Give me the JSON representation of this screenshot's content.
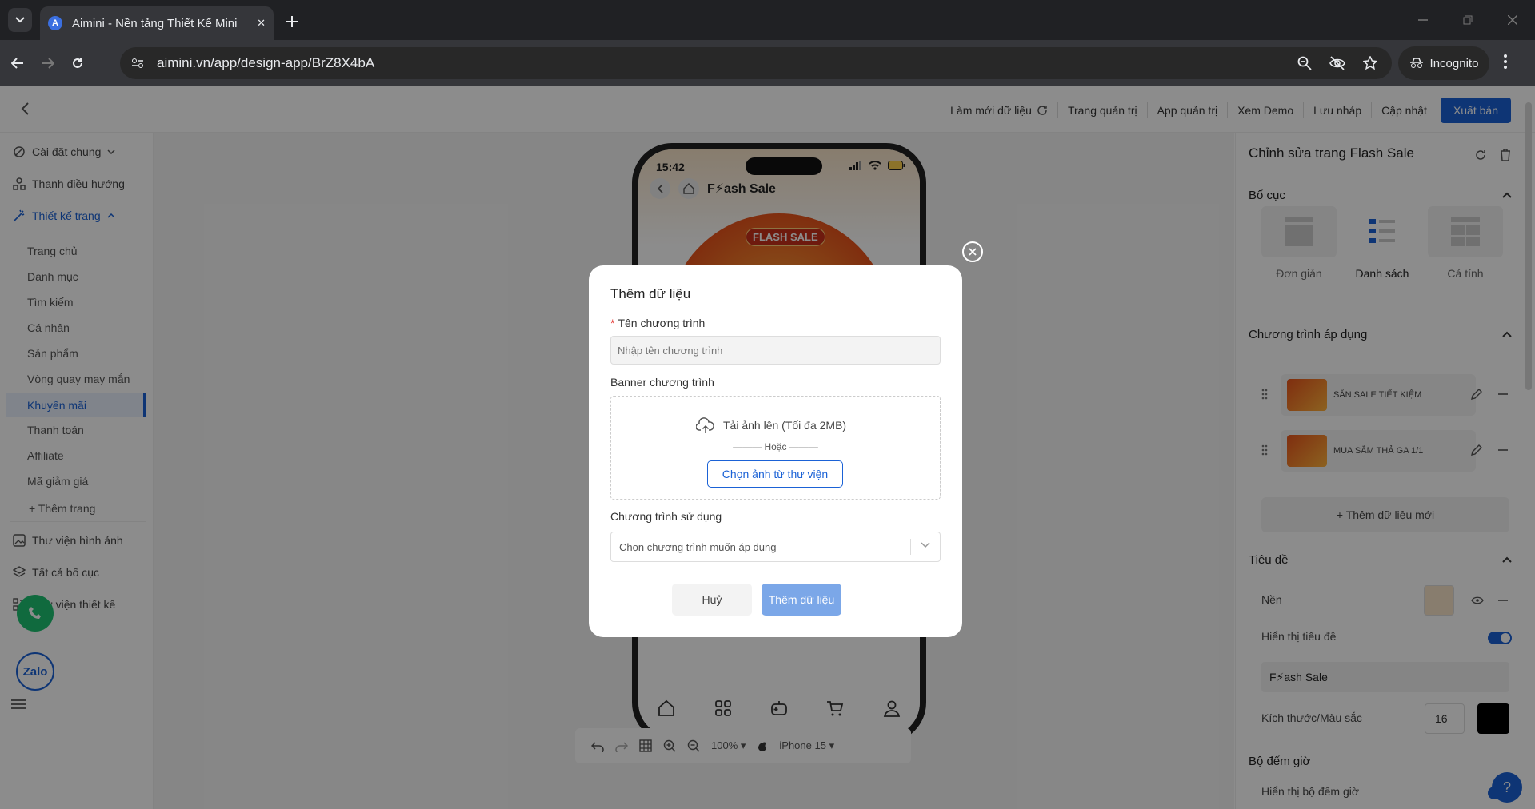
{
  "browser": {
    "tab_title": "Aimini - Nền tảng Thiết Kế Mini",
    "url": "aimini.vn/app/design-app/BrZ8X4bA",
    "incognito_label": "Incognito"
  },
  "topbar": {
    "links": [
      "Làm mới dữ liệu",
      "Trang quản trị",
      "App quản trị",
      "Xem Demo",
      "Lưu nháp",
      "Cập nhật"
    ],
    "publish": "Xuất bản"
  },
  "sidebar": {
    "general": "Cài đặt chung",
    "nav": "Thanh điều hướng",
    "design": "Thiết kế trang",
    "pages": [
      "Trang chủ",
      "Danh mục",
      "Tìm kiếm",
      "Cá nhân",
      "Sản phẩm",
      "Vòng quay may mắn",
      "Khuyến mãi",
      "Thanh toán",
      "Affiliate",
      "Mã giảm giá"
    ],
    "add_page": "+ Thêm trang",
    "image_lib": "Thư viện hình ảnh",
    "all_layouts": "Tất cả bố cục",
    "design_lib": "Thư viện thiết kế",
    "zalo": "Zalo"
  },
  "phone": {
    "time": "15:42",
    "title": "F⚡ash Sale",
    "banner_label": "FLASH SALE"
  },
  "canvas_tools": {
    "zoom": "100%",
    "device": "iPhone 15"
  },
  "right_panel": {
    "title": "Chỉnh sửa trang Flash Sale",
    "layout_heading": "Bố cục",
    "layouts": [
      "Đơn giản",
      "Danh sách",
      "Cá tính"
    ],
    "programs_heading": "Chương trình áp dụng",
    "programs": [
      "SĂN SALE TIẾT KIỆM",
      "MUA SẮM THẢ GA 1/1"
    ],
    "add_new": "+ Thêm dữ liệu mới",
    "title_heading": "Tiêu đề",
    "bg_label": "Nền",
    "show_title_label": "Hiển thị tiêu đề",
    "title_value": "F⚡ash Sale",
    "size_color_label": "Kích thước/Màu sắc",
    "size_value": "16",
    "timer_heading": "Bộ đếm giờ",
    "show_timer_label": "Hiển thị bộ đếm giờ",
    "help": "?"
  },
  "modal": {
    "title": "Thêm dữ liệu",
    "name_label": "Tên chương trình",
    "name_placeholder": "Nhập tên chương trình",
    "banner_label": "Banner chương trình",
    "upload_text": "Tải ảnh lên (Tối đa 2MB)",
    "or_text": "——— Hoặc ———",
    "library_button": "Chọn ảnh từ thư viện",
    "usage_label": "Chương trình sử dụng",
    "usage_placeholder": "Chọn chương trình muốn áp dụng",
    "cancel": "Huỷ",
    "submit": "Thêm dữ liệu"
  }
}
